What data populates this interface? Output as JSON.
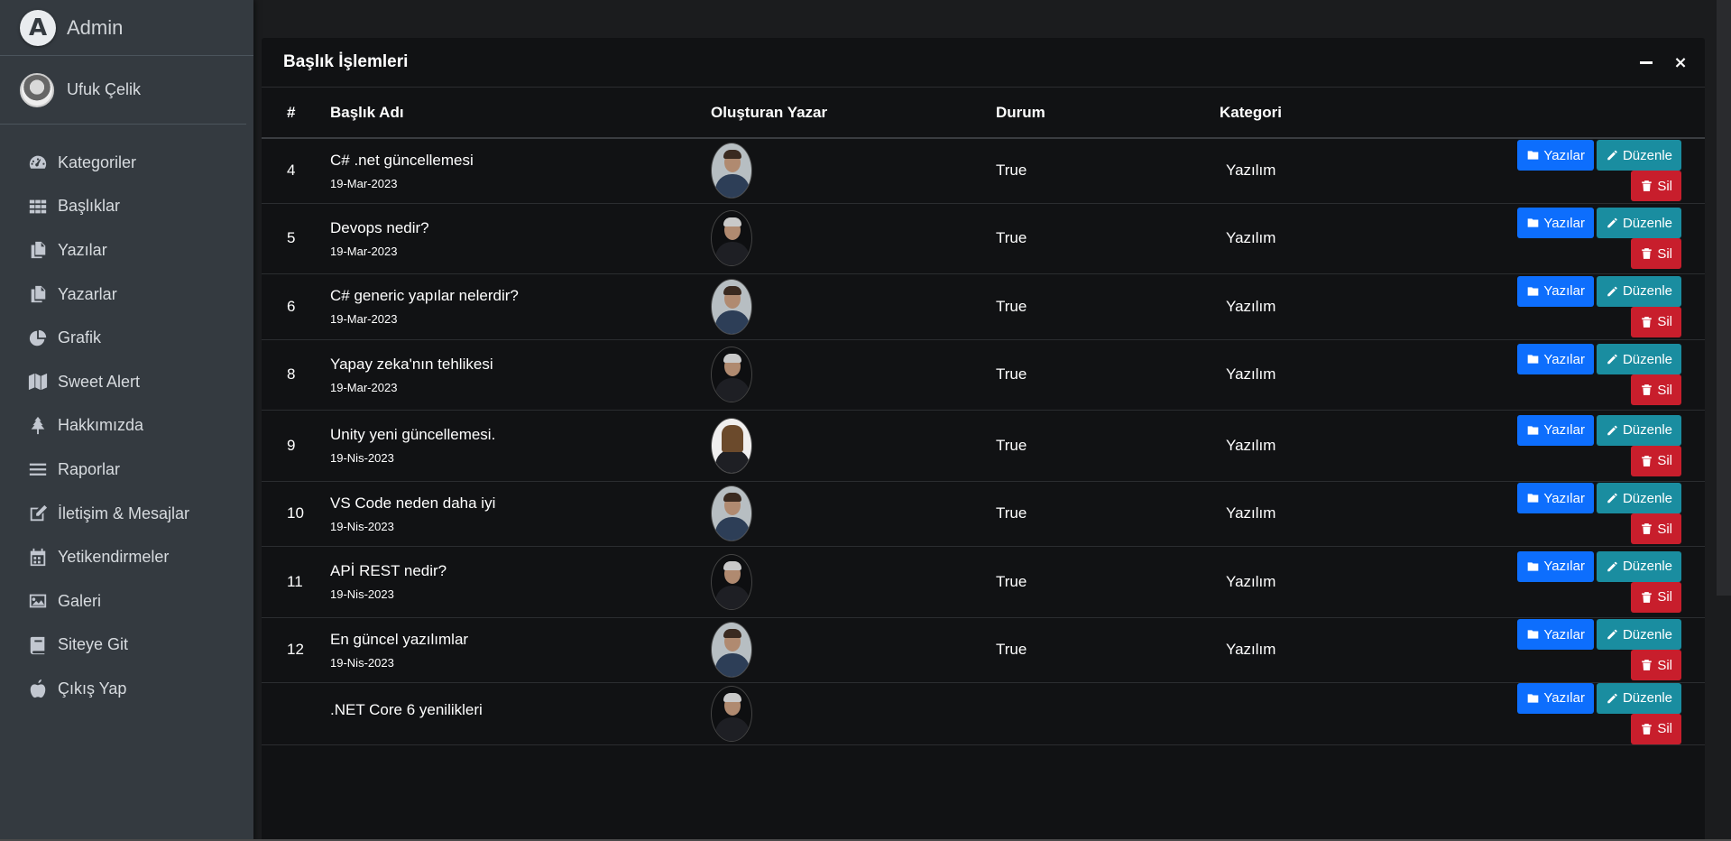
{
  "brand": {
    "logo_letter": "A",
    "name": "Admin"
  },
  "user": {
    "name": "Ufuk Çelik"
  },
  "sidebar": {
    "items": [
      {
        "label": "Kategoriler",
        "icon": "dashboard-gauge-icon"
      },
      {
        "label": "Başlıklar",
        "icon": "grid-icon"
      },
      {
        "label": "Yazılar",
        "icon": "copy-icon"
      },
      {
        "label": "Yazarlar",
        "icon": "copy-icon"
      },
      {
        "label": "Grafik",
        "icon": "pie-chart-icon"
      },
      {
        "label": "Sweet Alert",
        "icon": "map-icon"
      },
      {
        "label": "Hakkımızda",
        "icon": "tree-icon"
      },
      {
        "label": "Raporlar",
        "icon": "list-icon"
      },
      {
        "label": "İletişim & Mesajlar",
        "icon": "edit-icon"
      },
      {
        "label": "Yetikendirmeler",
        "icon": "calendar-icon"
      },
      {
        "label": "Galeri",
        "icon": "image-icon"
      },
      {
        "label": "Siteye Git",
        "icon": "book-icon"
      },
      {
        "label": "Çıkış Yap",
        "icon": "apple-icon"
      }
    ]
  },
  "card": {
    "title": "Başlık İşlemleri",
    "minimize_icon": "minus-icon",
    "close_symbol": "×"
  },
  "table": {
    "headers": {
      "id": "#",
      "title": "Başlık Adı",
      "author": "Oluşturan Yazar",
      "status": "Durum",
      "category": "Kategori"
    },
    "buttons": {
      "posts": "Yazılar",
      "edit": "Düzenle",
      "delete": "Sil"
    },
    "rows": [
      {
        "id": "4",
        "title": "C# .net güncellemesi",
        "date": "19-Mar-2023",
        "status": "True",
        "category": "Yazılım",
        "avatar": "gray"
      },
      {
        "id": "5",
        "title": "Devops nedir?",
        "date": "19-Mar-2023",
        "status": "True",
        "category": "Yazılım",
        "avatar": "dark"
      },
      {
        "id": "6",
        "title": "C# generic yapılar nelerdir?",
        "date": "19-Mar-2023",
        "status": "True",
        "category": "Yazılım",
        "avatar": "gray"
      },
      {
        "id": "8",
        "title": "Yapay zeka'nın tehlikesi",
        "date": "19-Mar-2023",
        "status": "True",
        "category": "Yazılım",
        "avatar": "dark"
      },
      {
        "id": "9",
        "title": "Unity yeni güncellemesi.",
        "date": "19-Nis-2023",
        "status": "True",
        "category": "Yazılım",
        "avatar": "light"
      },
      {
        "id": "10",
        "title": "VS Code neden daha iyi",
        "date": "19-Nis-2023",
        "status": "True",
        "category": "Yazılım",
        "avatar": "gray"
      },
      {
        "id": "11",
        "title": "APİ REST nedir?",
        "date": "19-Nis-2023",
        "status": "True",
        "category": "Yazılım",
        "avatar": "dark"
      },
      {
        "id": "12",
        "title": "En güncel yazılımlar",
        "date": "19-Nis-2023",
        "status": "True",
        "category": "Yazılım",
        "avatar": "gray"
      },
      {
        "id": "",
        "title": ".NET Core 6 yenilikleri",
        "date": "",
        "status": "",
        "category": "",
        "avatar": "dark"
      }
    ]
  },
  "colors": {
    "primary": "#0d6efd",
    "info": "#1a8da0",
    "danger": "#c81e2c",
    "sidebar": "#343a40",
    "card": "#111214"
  }
}
